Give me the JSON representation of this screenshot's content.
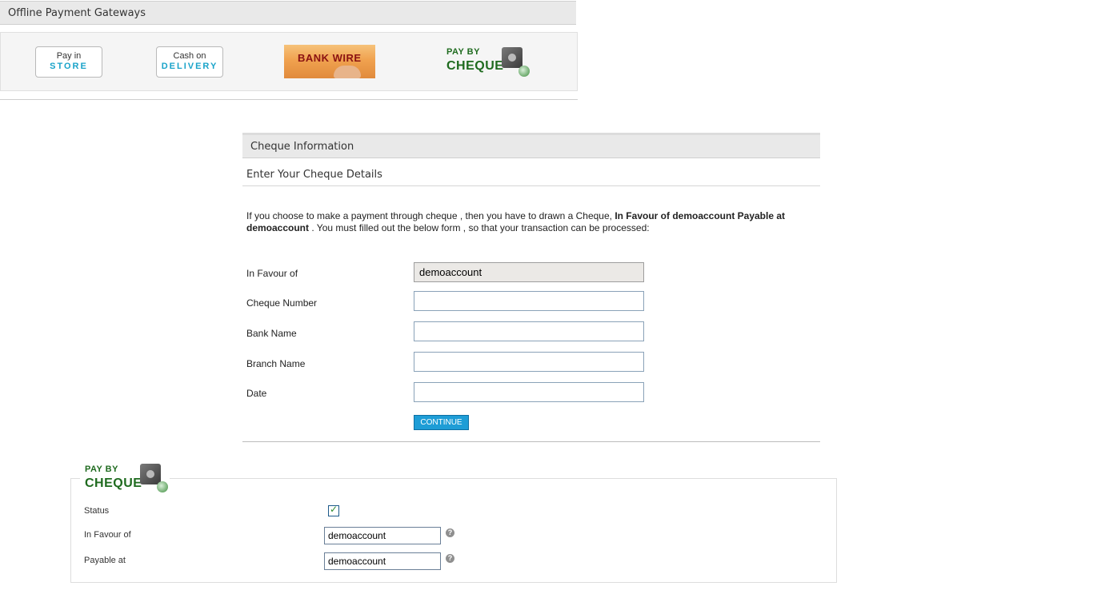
{
  "offline_gateways": {
    "title": "Offline Payment Gateways",
    "gateways": [
      {
        "line1": "Pay in",
        "line2": "STORE"
      },
      {
        "line1": "Cash on",
        "line2": "DELIVERY"
      },
      {
        "label": "BANK WIRE"
      },
      {
        "line1": "PAY BY",
        "line2": "CHEQUE"
      }
    ]
  },
  "cheque_info": {
    "title": "Cheque Information",
    "subtitle": "Enter Your Cheque Details",
    "desc_part1": "If you choose to make a payment through cheque , then you have to drawn a Cheque, ",
    "desc_bold": "In Favour of demoaccount Payable at demoaccount",
    "desc_part2": " . You must filled out the below form , so that your transaction can be processed:",
    "fields": {
      "favour": {
        "label": "In Favour of",
        "value": "demoaccount"
      },
      "cheque_number": {
        "label": "Cheque Number",
        "value": ""
      },
      "bank_name": {
        "label": "Bank Name",
        "value": ""
      },
      "branch_name": {
        "label": "Branch Name",
        "value": ""
      },
      "date": {
        "label": "Date",
        "value": ""
      }
    },
    "continue_label": "CONTINUE"
  },
  "settings": {
    "logo_line1": "PAY BY",
    "logo_line2": "CHEQUE",
    "status_label": "Status",
    "status_checked": true,
    "favour_label": "In Favour of",
    "favour_value": "demoaccount",
    "payable_label": "Payable at",
    "payable_value": "demoaccount",
    "help_glyph": "?"
  }
}
